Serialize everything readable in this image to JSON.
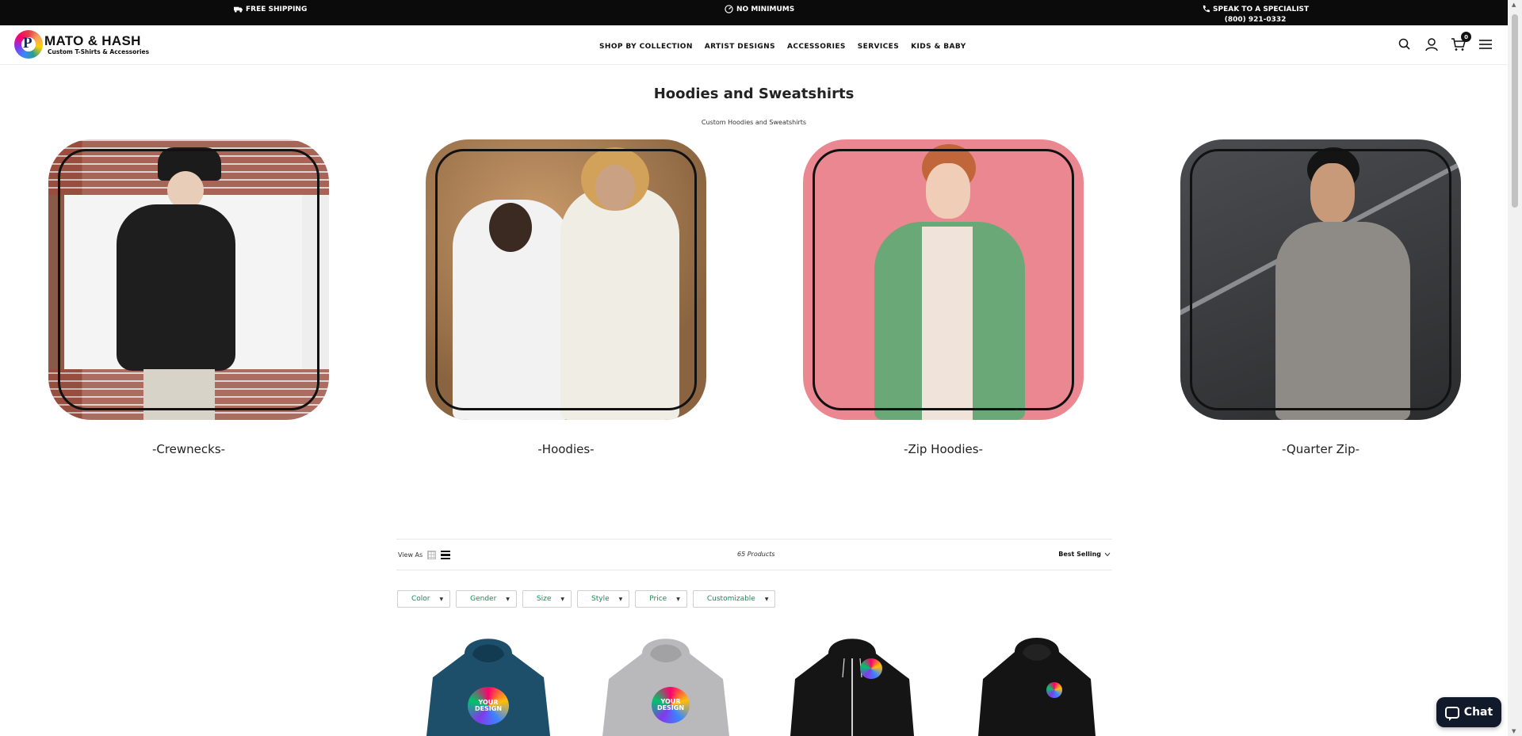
{
  "announcement": {
    "shipping": "FREE SHIPPING",
    "minimums": "NO MINIMUMS",
    "specialist": "SPEAK TO A SPECIALIST",
    "phone": "(800) 921-0332"
  },
  "header": {
    "logo_name": "MATO & HASH",
    "logo_sub": "Custom T-Shirts & Accessories",
    "nav": [
      "SHOP BY COLLECTION",
      "ARTIST DESIGNS",
      "ACCESSORIES",
      "SERVICES",
      "KIDS & BABY"
    ],
    "cart_count": "0"
  },
  "page": {
    "title": "Hoodies and Sweatshirts",
    "subtitle": "Custom Hoodies and Sweatshirts"
  },
  "collections": [
    {
      "label": "-Crewnecks-",
      "bg": "#e9e6e4"
    },
    {
      "label": "-Hoodies-",
      "bg": "#a8825a"
    },
    {
      "label": "-Zip Hoodies-",
      "bg": "#e9818b"
    },
    {
      "label": "-Quarter Zip-",
      "bg": "#3a3b3d"
    }
  ],
  "toolbar": {
    "view_as": "View As",
    "count": "65  Products",
    "sort": "Best Selling"
  },
  "filters": [
    "Color",
    "Gender",
    "Size",
    "Style",
    "Price",
    "Customizable"
  ],
  "products": [
    {
      "color": "#1d4f6b"
    },
    {
      "color": "#b9b9bb"
    },
    {
      "color": "#151515"
    },
    {
      "color": "#141414"
    }
  ],
  "chat": {
    "label": "Chat"
  }
}
